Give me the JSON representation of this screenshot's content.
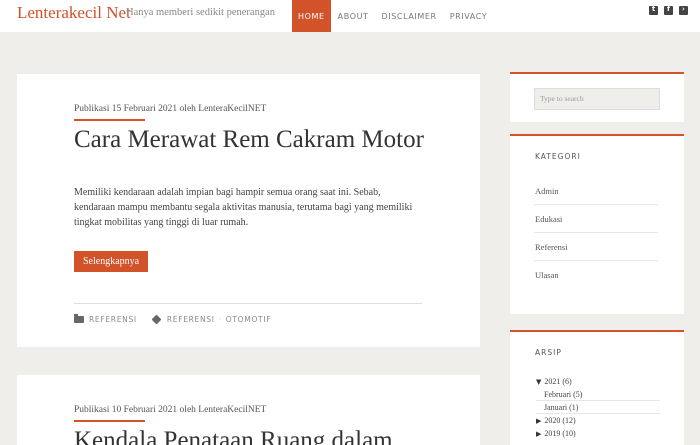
{
  "header": {
    "brand": "Lenterakecil Net",
    "tagline": "Hanya memberi sedikit penerangan",
    "nav": [
      "HOME",
      "ABOUT",
      "DISCLAIMER",
      "PRIVACY"
    ],
    "social_icons": [
      "twitter-icon",
      "facebook-icon",
      "rss-icon"
    ]
  },
  "posts": [
    {
      "meta": "Publikasi 15 Februari 2021 oleh LenteraKecilNET",
      "title": "Cara Merawat Rem Cakram Motor",
      "excerpt": "Memiliki kendaraan adalah impian bagi hampir semua orang saat ini. Sebab, kendaraan mampu membantu segala aktivitas manusia, terutama bagi yang memiliki tingkat mobilitas yang tinggi di luar rumah.",
      "button": "Selengkapnya",
      "category": "REFERENSI",
      "tags": [
        "REFERENSI",
        "OTOMOTIF"
      ]
    },
    {
      "meta": "Publikasi 10 Februari 2021 oleh LenteraKecilNET",
      "title": "Kendala Penataan Ruang dalam"
    }
  ],
  "sidebar": {
    "search_placeholder": "Type to search",
    "kategori_title": "KATEGORI",
    "categories": [
      "Admin",
      "Edukasi",
      "Referensi",
      "Ulasan"
    ],
    "arsip_title": "ARSIP",
    "arsip": {
      "y2021": "2021 (6)",
      "feb": "Februari (5)",
      "jan": "Januari (1)",
      "y2020": "2020 (12)",
      "y2019": "2019 (10)"
    }
  },
  "colors": {
    "accent": "#d2522a",
    "background": "#efeeea"
  }
}
